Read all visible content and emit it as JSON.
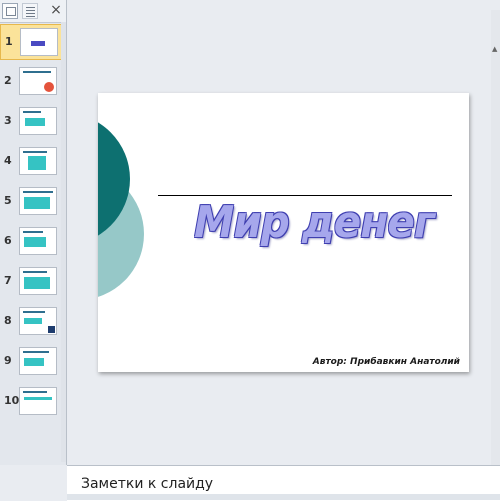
{
  "panel": {
    "close_glyph": "×",
    "slides": [
      {
        "number": "1",
        "selected": true
      },
      {
        "number": "2"
      },
      {
        "number": "3"
      },
      {
        "number": "4"
      },
      {
        "number": "5"
      },
      {
        "number": "6"
      },
      {
        "number": "7"
      },
      {
        "number": "8"
      },
      {
        "number": "9"
      },
      {
        "number": "10"
      }
    ]
  },
  "slide": {
    "title": "Мир денег",
    "author": "Автор: Прибавкин Анатолий",
    "colors": {
      "circle_dark": "#0d7070",
      "circle_light": "#96c8c8",
      "title_fill": "#a6a7ec",
      "title_outline": "#3f3fb0"
    }
  },
  "notes": {
    "placeholder": "Заметки к слайду"
  }
}
